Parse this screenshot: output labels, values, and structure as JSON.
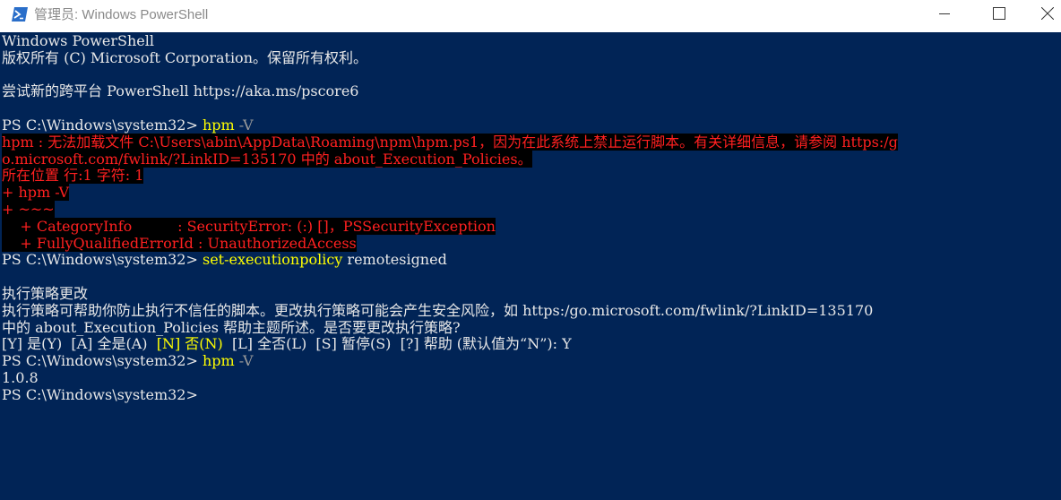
{
  "window": {
    "title": "管理员: Windows PowerShell"
  },
  "console": {
    "banner_line1": "Windows PowerShell",
    "banner_line2": "版权所有 (C) Microsoft Corporation。保留所有权利。",
    "banner_line4": "尝试新的跨平台 PowerShell https://aka.ms/pscore6",
    "prompt": "PS C:\\Windows\\system32> ",
    "cmd1_name": "hpm",
    "cmd1_param": " -V",
    "error_line1": "hpm : 无法加载文件 C:\\Users\\abin\\AppData\\Roaming\\npm\\hpm.ps1，因为在此系统上禁止运行脚本。有关详细信息，请参阅 https:/g",
    "error_line2": "o.microsoft.com/fwlink/?LinkID=135170 中的 about_Execution_Policies。",
    "error_line3": "所在位置 行:1 字符: 1",
    "error_line4": "+ hpm -V",
    "error_line5": "+ ~~~",
    "error_line6": "    + CategoryInfo          : SecurityError: (:) []，PSSecurityException",
    "error_line7": "    + FullyQualifiedErrorId : UnauthorizedAccess",
    "cmd2_name": "set-executionpolicy",
    "cmd2_arg": " remotesigned",
    "policy_heading": "执行策略更改",
    "policy_desc1": "执行策略可帮助你防止执行不信任的脚本。更改执行策略可能会产生安全风险，如 https:/go.microsoft.com/fwlink/?LinkID=135170",
    "policy_desc2": "中的 about_Execution_Policies 帮助主题所述。是否要更改执行策略?",
    "choice_part1": "[Y] 是(Y)  [A] 全是(A)  ",
    "choice_default": "[N] 否(N)",
    "choice_part2": "  [L] 全否(L)  [S] 暂停(S)  [?] 帮助 (默认值为“N”): Y",
    "cmd3_name": "hpm",
    "cmd3_param": " -V",
    "version_output": "1.0.8"
  },
  "colors": {
    "console_bg": "#012456",
    "console_text": "#e8e8e8",
    "command": "#ffff00",
    "parameter": "#9a9a9a",
    "error_fg": "#ff2020",
    "error_bg": "#000000"
  },
  "icons": {
    "app": "powershell-icon",
    "minimize": "minimize-icon",
    "maximize": "maximize-icon",
    "close": "close-icon"
  }
}
